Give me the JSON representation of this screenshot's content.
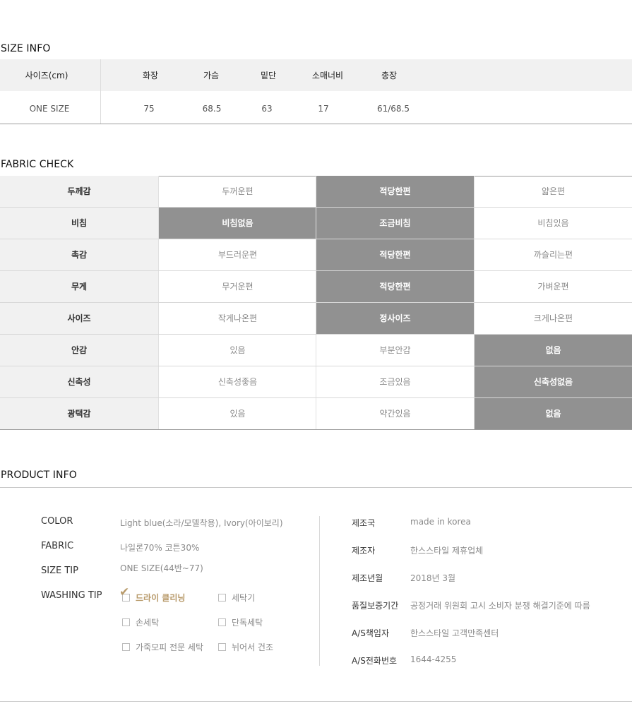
{
  "size_info": {
    "title": "SIZE INFO",
    "headers": [
      "사이즈(cm)",
      "화장",
      "가슴",
      "밑단",
      "소매너비",
      "총장"
    ],
    "row": [
      "ONE SIZE",
      "75",
      "68.5",
      "63",
      "17",
      "61/68.5"
    ]
  },
  "fabric_check": {
    "title": "FABRIC CHECK",
    "rows": [
      {
        "label": "두께감",
        "options": [
          "두꺼운편",
          "적당한편",
          "얇은편"
        ],
        "selected": [
          1
        ]
      },
      {
        "label": "비침",
        "options": [
          "비침없음",
          "조금비침",
          "비침있음"
        ],
        "selected": [
          0,
          1
        ]
      },
      {
        "label": "촉감",
        "options": [
          "부드러운편",
          "적당한편",
          "까슬리는편"
        ],
        "selected": [
          1
        ]
      },
      {
        "label": "무게",
        "options": [
          "무거운편",
          "적당한편",
          "가벼운편"
        ],
        "selected": [
          1
        ]
      },
      {
        "label": "사이즈",
        "options": [
          "작게나온편",
          "정사이즈",
          "크게나온편"
        ],
        "selected": [
          1
        ]
      },
      {
        "label": "안감",
        "options": [
          "있음",
          "부분안감",
          "없음"
        ],
        "selected": [
          2
        ]
      },
      {
        "label": "신축성",
        "options": [
          "신축성좋음",
          "조금있음",
          "신축성없음"
        ],
        "selected": [
          2
        ]
      },
      {
        "label": "광택감",
        "options": [
          "있음",
          "약간있음",
          "없음"
        ],
        "selected": [
          2
        ]
      }
    ],
    "selected_bg": "#919191",
    "label_bg": "#f1f1f1"
  },
  "product_info": {
    "title": "PRODUCT INFO",
    "color_label": "COLOR",
    "color_value": "Light blue(소라/모델착용), Ivory(아이보리)",
    "fabric_label": "FABRIC",
    "fabric_value": "나일론70% 코튼30%",
    "size_tip_label": "SIZE TIP",
    "size_tip_value": "ONE SIZE(44반~77)",
    "washing_label": "WASHING TIP",
    "washing": [
      {
        "label": "드라이 클리닝",
        "checked": true
      },
      {
        "label": "세탁기",
        "checked": false
      },
      {
        "label": "손세탁",
        "checked": false
      },
      {
        "label": "단독세탁",
        "checked": false
      },
      {
        "label": "가죽모피 전문 세탁",
        "checked": false
      },
      {
        "label": "뉘어서 건조",
        "checked": false
      }
    ],
    "check_color": "#b89a6a",
    "details": [
      {
        "label": "제조국",
        "value": "made in korea"
      },
      {
        "label": "제조자",
        "value": "한스스타일 제휴업체"
      },
      {
        "label": "제조년월",
        "value": "2018년 3월"
      },
      {
        "label": "품질보증기간",
        "value": "공정거래 위원회 고시 소비자 분쟁 해결기준에 따름"
      },
      {
        "label": "A/S책임자",
        "value": "한스스타일 고객만족센터"
      },
      {
        "label": "A/S전화번호",
        "value": "1644-4255"
      }
    ]
  }
}
